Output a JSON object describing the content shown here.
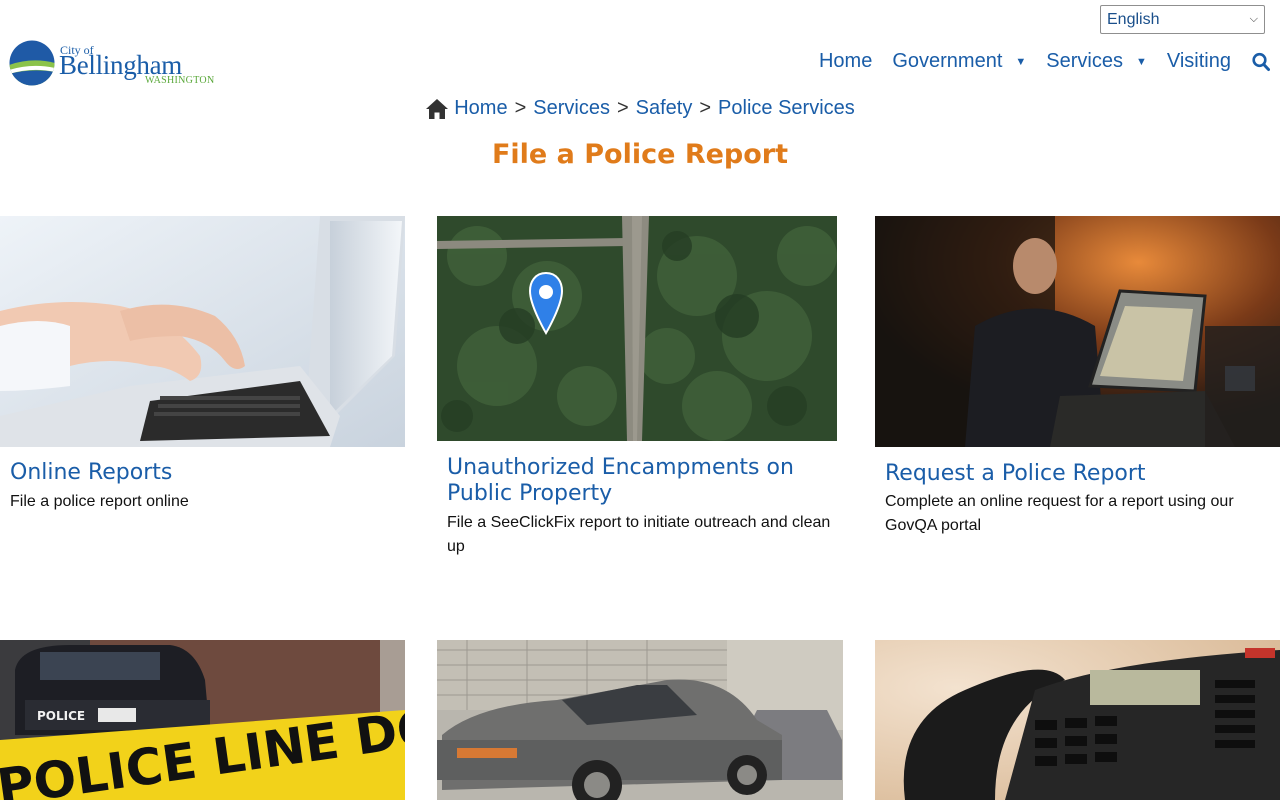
{
  "language_select": {
    "selected": "English"
  },
  "logo": {
    "city_of": "City of",
    "name": "Bellingham",
    "state": "WASHINGTON"
  },
  "nav": {
    "items": [
      {
        "label": "Home",
        "has_dropdown": false
      },
      {
        "label": "Government",
        "has_dropdown": true
      },
      {
        "label": "Services",
        "has_dropdown": true
      },
      {
        "label": "Visiting",
        "has_dropdown": false
      }
    ],
    "search_icon": "search-icon"
  },
  "breadcrumb": {
    "home_icon": "home-icon",
    "items": [
      "Home",
      "Services",
      "Safety",
      "Police Services"
    ],
    "separator": ">"
  },
  "page_title": "File a Police Report",
  "cards": [
    {
      "title": "Online Reports",
      "description": "File a police report online",
      "image": "hands-typing-on-laptop"
    },
    {
      "title": "Unauthorized Encampments on Public Property",
      "description": "File a SeeClickFix report to initiate outreach and clean up",
      "image": "aerial-map-with-location-pin"
    },
    {
      "title": "Request a Police Report",
      "description": "Complete an online request for a report using our GovQA portal",
      "image": "officer-using-laptop-in-patrol-car"
    },
    {
      "image": "police-line-tape-with-patrol-car",
      "tape_text": "POLICE LINE DO NOT CROSS",
      "car_text": "POLICE"
    },
    {
      "image": "abandoned-cars-in-lot"
    },
    {
      "image": "desk-telephone"
    }
  ],
  "colors": {
    "link_blue": "#1a5da8",
    "title_orange": "#e07b1a",
    "logo_green": "#5aa83a"
  }
}
